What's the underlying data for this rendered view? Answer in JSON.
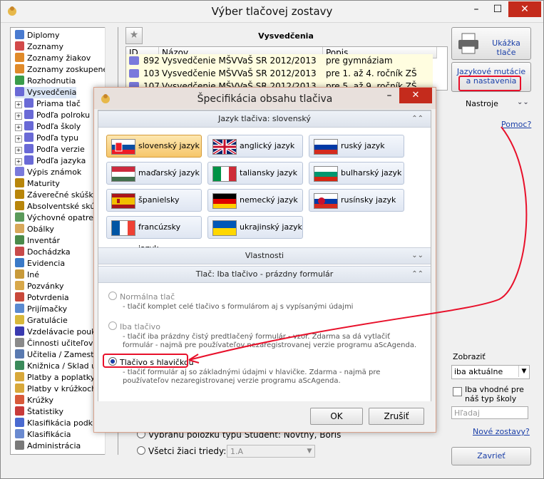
{
  "window": {
    "title": "Výber tlačovej zostavy",
    "min": "–",
    "max": "☐",
    "close": "✕"
  },
  "tree": {
    "items": [
      {
        "label": "Diplomy",
        "color": "#4a7bd0",
        "indent": 0
      },
      {
        "label": "Zoznamy",
        "color": "#d24a4a",
        "indent": 0
      },
      {
        "label": "Zoznamy žiakov",
        "color": "#e08a2a",
        "indent": 0
      },
      {
        "label": "Zoznamy zoskupené",
        "color": "#e08a2a",
        "indent": 0
      },
      {
        "label": "Rozhodnutia",
        "color": "#3a9c4a",
        "indent": 0
      },
      {
        "label": "Vysvedčenia",
        "color": "#6a6ad6",
        "indent": 0
      },
      {
        "label": "Priama tlač",
        "color": "#6a6ad6",
        "indent": 1
      },
      {
        "label": "Podľa polroku",
        "color": "#6a6ad6",
        "indent": 1
      },
      {
        "label": "Podľa školy",
        "color": "#6a6ad6",
        "indent": 1
      },
      {
        "label": "Podľa typu",
        "color": "#6a6ad6",
        "indent": 1
      },
      {
        "label": "Podľa verzie",
        "color": "#6a6ad6",
        "indent": 1
      },
      {
        "label": "Podľa jazyka",
        "color": "#6a6ad6",
        "indent": 1
      },
      {
        "label": "Výpis známok",
        "color": "#7a7adc",
        "indent": 0
      },
      {
        "label": "Maturity",
        "color": "#b8860b",
        "indent": 0
      },
      {
        "label": "Záverečné skúšky",
        "color": "#b8860b",
        "indent": 0
      },
      {
        "label": "Absolventské skúšk",
        "color": "#b8860b",
        "indent": 0
      },
      {
        "label": "Výchovné opatrenia",
        "color": "#5a9a5a",
        "indent": 0
      },
      {
        "label": "Obálky",
        "color": "#d8a85a",
        "indent": 0
      },
      {
        "label": "Inventár",
        "color": "#4a8a4a",
        "indent": 0
      },
      {
        "label": "Dochádzka",
        "color": "#c84a4a",
        "indent": 0
      },
      {
        "label": "Evidencia",
        "color": "#3a7ac8",
        "indent": 0
      },
      {
        "label": "Iné",
        "color": "#c89a3a",
        "indent": 0
      },
      {
        "label": "Pozvánky",
        "color": "#d8a84a",
        "indent": 0
      },
      {
        "label": "Potvrdenia",
        "color": "#c8483a",
        "indent": 0
      },
      {
        "label": "Prijímačky",
        "color": "#5a8ad0",
        "indent": 0
      },
      {
        "label": "Gratulácie",
        "color": "#d8b83a",
        "indent": 0
      },
      {
        "label": "Vzdelávacie poukaz",
        "color": "#3a3ab0",
        "indent": 0
      },
      {
        "label": "Činnosti učiteľov",
        "color": "#8a8a8a",
        "indent": 0
      },
      {
        "label": "Učitelia / Zamestna",
        "color": "#5a7ab0",
        "indent": 0
      },
      {
        "label": "Knižnica / Sklad uč",
        "color": "#3a8a5a",
        "indent": 0
      },
      {
        "label": "Platby a poplatky",
        "color": "#d8a83a",
        "indent": 0
      },
      {
        "label": "Platby v krúžkoch",
        "color": "#d8a83a",
        "indent": 0
      },
      {
        "label": "Krúžky",
        "color": "#d85a3a",
        "indent": 0
      },
      {
        "label": "Štatistiky",
        "color": "#c83a3a",
        "indent": 0
      },
      {
        "label": "Klasifikácia podklad",
        "color": "#4a6ad0",
        "indent": 0
      },
      {
        "label": "Klasifikácia",
        "color": "#6a8ad0",
        "indent": 0
      },
      {
        "label": "Administrácia",
        "color": "#7a7a7a",
        "indent": 0
      }
    ]
  },
  "panel": {
    "title": "Vysvedčenia",
    "star": "★",
    "columns": {
      "id": "ID",
      "name": "Názov",
      "desc": "Popis"
    },
    "rows": [
      {
        "id": "892",
        "name": "Vysvedčenie MŠVVaŠ SR 2012/2013",
        "desc": "pre gymnáziam"
      },
      {
        "id": "103",
        "name": "Vysvedčenie MŠVVaŠ SR 2012/2013",
        "desc": "pre 1. až 4. ročník ZŠ"
      },
      {
        "id": "107",
        "name": "Vysvedčenie MŠVVaŠ SR 2012/2013",
        "desc": "pre 5. až 9. ročník ZŠ"
      }
    ]
  },
  "right": {
    "preview_label": "Ukážka tlače",
    "lang_line1": "Jazykové mutácie",
    "lang_line2": "a nastavenia",
    "nastroje": "Nastroje",
    "pomoc": "Pomoc?",
    "zobrazit_label": "Zobraziť",
    "zobrazit_value": "iba aktuálne",
    "vhodne_label": "Iba vhodné pre náš typ školy",
    "hladaj_placeholder": "Hľadaj",
    "nove_zostavy": "Nové zostavy?",
    "zavriet": "Zavrieť"
  },
  "bottom": {
    "student_label": "Vybranú položku typu Student: Novtny, Boris",
    "vsetci_label": "Všetci žiaci triedy:",
    "trieda_value": "1.A"
  },
  "dialog": {
    "title": "Špecifikácia obsahu tlačiva",
    "close": "✕",
    "min": "–",
    "section_language": "Jazyk tlačiva: slovenský",
    "section_props": "Vlastnosti",
    "section_print": "Tlač: Iba tlačivo - prázdny formulár",
    "languages": [
      {
        "label": "slovenský jazyk",
        "flag": "sk",
        "selected": true
      },
      {
        "label": "anglický jazyk",
        "flag": "gb",
        "selected": false
      },
      {
        "label": "ruský jazyk",
        "flag": "ru",
        "selected": false
      },
      {
        "label": "maďarský jazyk",
        "flag": "hu",
        "selected": false
      },
      {
        "label": "taliansky jazyk",
        "flag": "it",
        "selected": false
      },
      {
        "label": "bulharský jazyk",
        "flag": "bg",
        "selected": false
      },
      {
        "label": "španielsky jazyk",
        "flag": "es",
        "selected": false
      },
      {
        "label": "nemecký jazyk",
        "flag": "de",
        "selected": false
      },
      {
        "label": "rusínsky jazyk",
        "flag": "rue",
        "selected": false
      },
      {
        "label": "francúzsky jazyk",
        "flag": "fr",
        "selected": false
      },
      {
        "label": "ukrajinský jazyk",
        "flag": "ua",
        "selected": false
      }
    ],
    "options": [
      {
        "label": "Normálna tlač",
        "desc": "- tlačiť komplet celé tlačivo s formulárom aj s vypísanými údajmi",
        "selected": false
      },
      {
        "label": "Iba tlačivo",
        "desc": "- tlačiť iba prázdny čistý predtlačený formulár - vzor. Zdarma sa dá vytlačiť formulár - najmä pre používateľov nezaregistrovanej verzie programu aScAgenda.",
        "selected": false
      },
      {
        "label": "Tlačivo s hlavičkou",
        "desc": "- tlačiť formulár aj so základnými údajmi v hlavičke. Zdarma - najmä pre používateľov nezaregistrovanej verzie programu aScAgenda.",
        "selected": true
      }
    ],
    "ok": "OK",
    "cancel": "Zrušiť"
  },
  "colors": {
    "accent_red": "#e8102a",
    "link_blue": "#1a3fa8",
    "selected_lang": "#f6c66a"
  }
}
